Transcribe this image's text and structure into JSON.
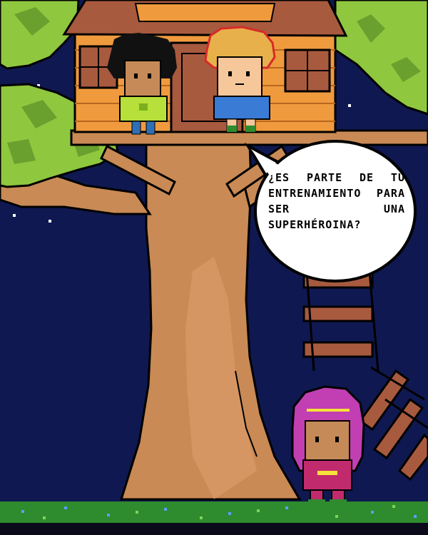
{
  "dialogue": {
    "text": "¿Es parte de tu entrenamiento para ser una superhéroina?"
  },
  "characters": [
    {
      "name": "curly-hair-kid",
      "shirt_color": "#b7e03a",
      "hair_color": "#111111"
    },
    {
      "name": "blond-kid",
      "shirt_color": "#3a7bd5",
      "hair_color": "#e8b04a"
    },
    {
      "name": "hooded-girl",
      "hood_color": "#c23fb3",
      "outfit_color": "#c22a6e"
    }
  ],
  "colors": {
    "night_sky": "#0f1850",
    "trunk": "#c98a55",
    "leaves": "#8fc73e",
    "house": "#f09a3e",
    "roof": "#a85a3e",
    "grass": "#2e8b2e"
  }
}
